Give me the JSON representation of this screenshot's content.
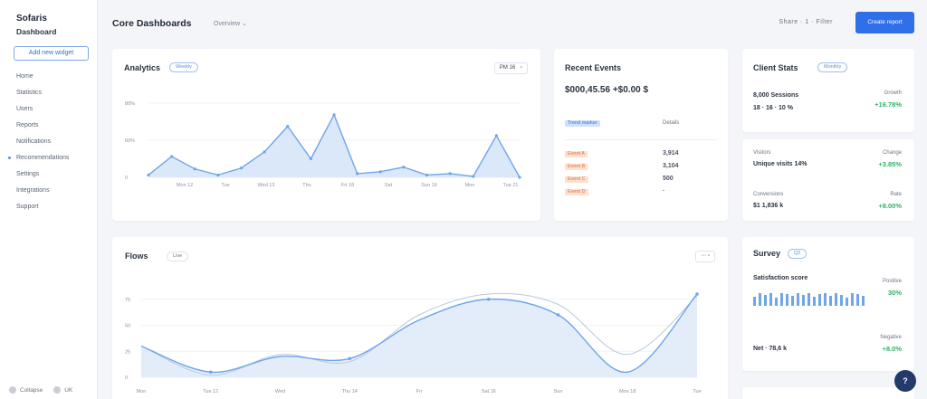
{
  "sidebar": {
    "brand": "Sofaris",
    "brand_sub": "Dashboard",
    "primary_action": "Add new widget",
    "items": [
      {
        "label": "Home"
      },
      {
        "label": "Statistics"
      },
      {
        "label": "Users"
      },
      {
        "label": "Reports"
      },
      {
        "label": "Notifications"
      },
      {
        "label": "Recommendations",
        "active": true
      },
      {
        "label": "Settings"
      },
      {
        "label": "Integrations"
      },
      {
        "label": "Support"
      }
    ],
    "footer_label": "Collapse",
    "footer_value": "UK"
  },
  "header": {
    "title": "Core Dashboards",
    "tag": "Overview",
    "links": "Share · 1 · Filter",
    "primary_button": "Create report"
  },
  "analytics": {
    "title": "Analytics",
    "pill": "Weekly",
    "control_label": "PM 16",
    "chart_data": {
      "type": "area",
      "x": [
        "Mon",
        "",
        "Tue",
        "",
        "Wed",
        "",
        "Thu",
        "",
        "Fri",
        "",
        "Sat",
        "",
        "Sun",
        "",
        "Mon",
        "",
        "Tue"
      ],
      "values": [
        5,
        45,
        18,
        5,
        20,
        55,
        110,
        40,
        135,
        8,
        12,
        22,
        5,
        8,
        2,
        90,
        0
      ],
      "ylim": [
        0,
        160
      ],
      "yticks": [
        "0",
        "60%",
        "80%"
      ],
      "xticks": [
        "Mon 12",
        "Tue",
        "Wed 13",
        "Thu",
        "Fri 18",
        "Sat",
        "Sun 19",
        "Mon",
        "Tue 21"
      ]
    }
  },
  "recent": {
    "title": "Recent Events",
    "headline": "$000,45.56 +$0.00 $",
    "tag_primary": "Trend marker",
    "col_head": "Details",
    "rows": [
      {
        "tag": "Event A",
        "value": "3,914"
      },
      {
        "tag": "Event B",
        "value": "3,104"
      },
      {
        "tag": "Event C",
        "value": "500"
      },
      {
        "tag": "Event D",
        "value": "·"
      }
    ]
  },
  "flows": {
    "title": "Flows",
    "pill": "Live",
    "control_label": "",
    "chart_data": {
      "type": "line",
      "series": [
        {
          "values": [
            30,
            5,
            20,
            18,
            55,
            75,
            60,
            5,
            80
          ]
        },
        {
          "values": [
            30,
            2,
            22,
            15,
            60,
            80,
            70,
            22,
            78
          ]
        }
      ],
      "ylim": [
        0,
        100
      ],
      "yticks": [
        "0",
        "25",
        "50",
        "75"
      ],
      "xticks": [
        "Mon",
        "Tue 12",
        "Wed",
        "Thu 14",
        "Fri",
        "Sat 16",
        "Sun",
        "Mon 18",
        "Tue"
      ]
    }
  },
  "client": {
    "title": "Client Stats",
    "pill": "Monthly",
    "cards": [
      {
        "label": "8,000 Sessions",
        "main": "18 · 16 · 10 %",
        "right_label": "Growth",
        "right_value": "+16.78%"
      },
      {
        "label": "Visitors",
        "main": "Unique visits 14%",
        "right_label": "Change",
        "right_value": "+3.85%"
      },
      {
        "label": "Conversions",
        "main": "$1 1,836 k",
        "right_label": "Rate",
        "right_value": "+8.00%"
      }
    ]
  },
  "survey": {
    "title": "Survey",
    "pill": "Q2",
    "rows": [
      {
        "label": "Satisfaction score",
        "right_label": "Positive",
        "right_value": "30%"
      },
      {
        "label": "Net · 78,6 k",
        "right_label": "Negative",
        "right_value": "+8.0%"
      }
    ]
  },
  "fab_label": "?"
}
